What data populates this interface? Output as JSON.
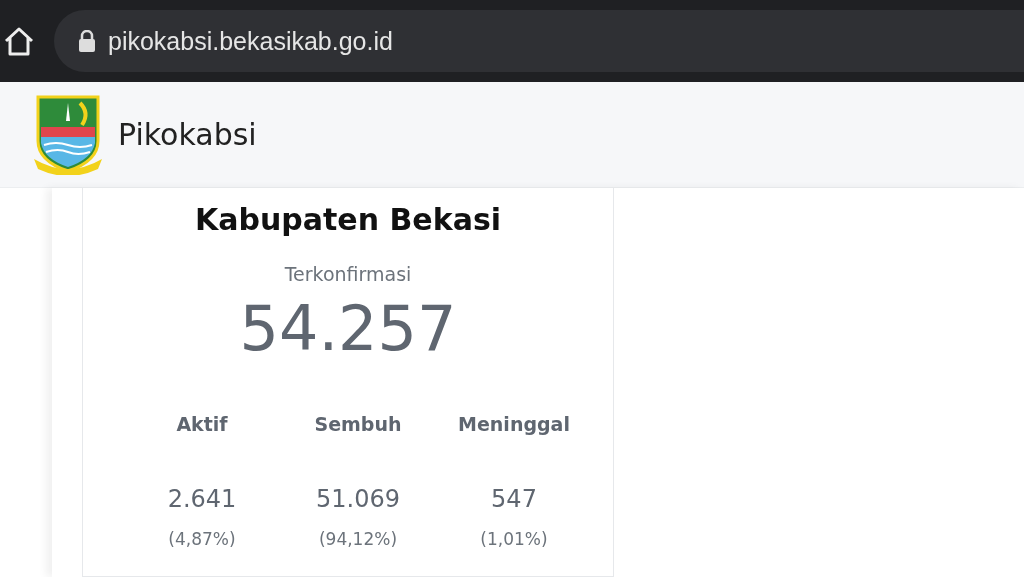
{
  "browser": {
    "url": "pikokabsi.bekasikab.go.id"
  },
  "header": {
    "title": "Pikokabsi"
  },
  "card": {
    "title": "Kabupaten Bekasi",
    "confirmed_label": "Terkonfirmasi",
    "confirmed_value": "54.257",
    "stats": [
      {
        "label": "Aktif",
        "value": "2.641",
        "percent": "(4,87%)"
      },
      {
        "label": "Sembuh",
        "value": "51.069",
        "percent": "(94,12%)"
      },
      {
        "label": "Meninggal",
        "value": "547",
        "percent": "(1,01%)"
      }
    ]
  }
}
